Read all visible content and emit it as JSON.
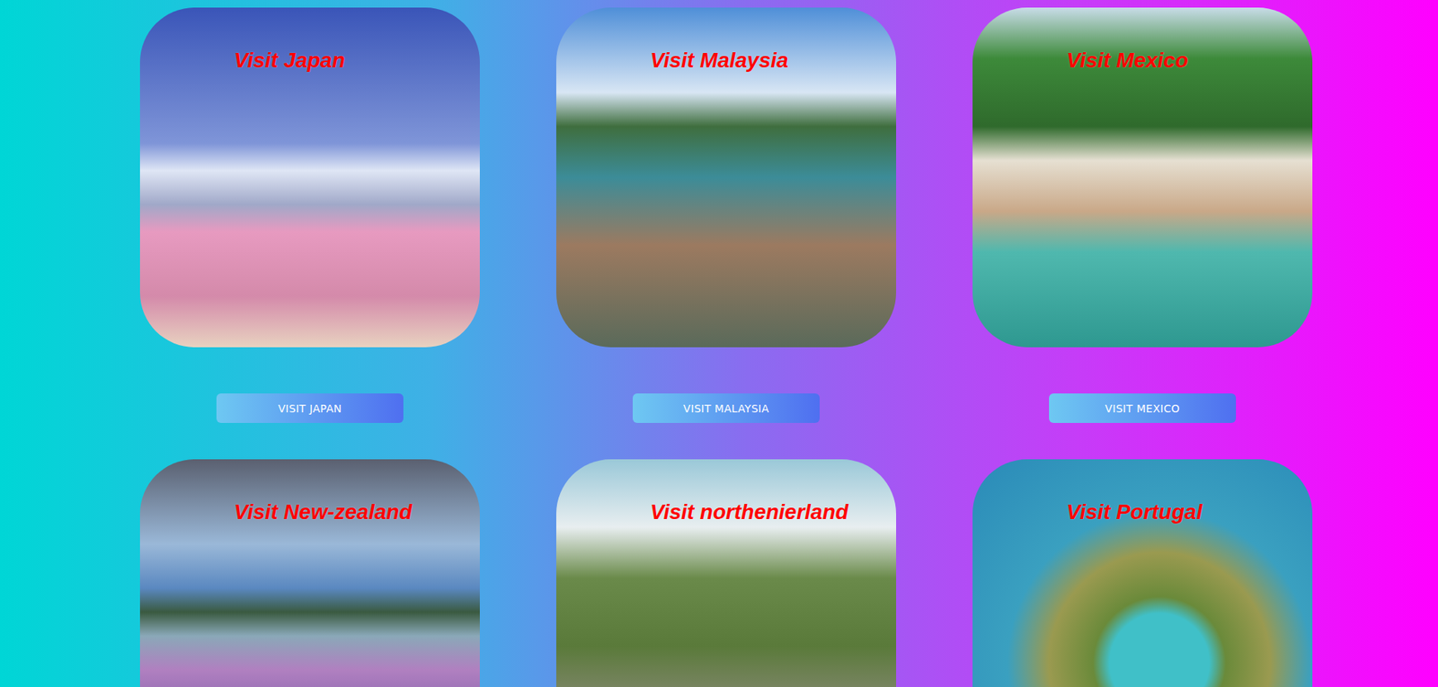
{
  "destinations": [
    {
      "title": "Visit Japan",
      "button": "VISIT JAPAN"
    },
    {
      "title": "Visit Malaysia",
      "button": "VISIT MALAYSIA"
    },
    {
      "title": "Visit Mexico",
      "button": "VISIT MEXICO"
    },
    {
      "title": "Visit New-zealand",
      "button": null
    },
    {
      "title": "Visit northenierland",
      "button": null
    },
    {
      "title": "Visit Portugal",
      "button": null
    }
  ]
}
